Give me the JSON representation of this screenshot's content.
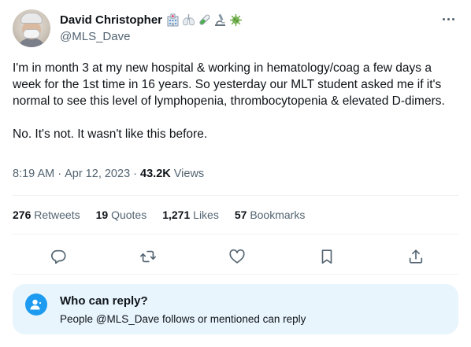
{
  "author": {
    "display_name": "David Christopher",
    "handle": "@MLS_Dave",
    "name_emojis": [
      "hospital-icon",
      "lungs-icon",
      "test-tube-icon",
      "microscope-icon",
      "virus-icon"
    ]
  },
  "tweet": {
    "paragraph_1": "I'm in month 3 at my new hospital & working in hematology/coag a few days a week for the 1st time in 16 years. So yesterday our MLT student asked me if it's normal to see this level of lymphopenia, thrombocytopenia & elevated D-dimers.",
    "paragraph_2": "No. It's not. It wasn't like this before."
  },
  "meta": {
    "time": "8:19 AM",
    "separator": " · ",
    "date": "Apr 12, 2023",
    "views_count": "43.2K",
    "views_label": " Views"
  },
  "stats": [
    {
      "count": "276",
      "label": "Retweets"
    },
    {
      "count": "19",
      "label": "Quotes"
    },
    {
      "count": "1,271",
      "label": "Likes"
    },
    {
      "count": "57",
      "label": "Bookmarks"
    }
  ],
  "actions": [
    "reply-icon",
    "retweet-icon",
    "like-icon",
    "bookmark-icon",
    "share-icon"
  ],
  "who_can_reply": {
    "title": "Who can reply?",
    "subtitle": "People @MLS_Dave follows or mentioned can reply"
  },
  "colors": {
    "text": "#0f1419",
    "secondary": "#536471",
    "accent": "#1d9bf0",
    "reply_box_bg": "#e8f5fd"
  }
}
